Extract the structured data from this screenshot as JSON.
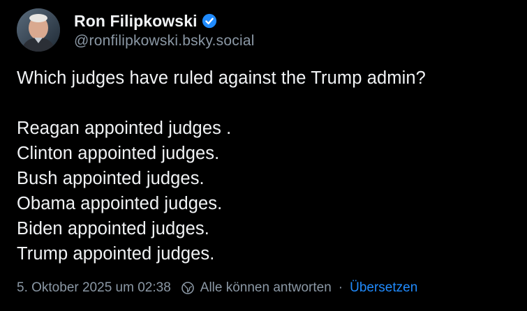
{
  "author": {
    "display_name": "Ron Filipkowski",
    "handle": "@ronfilipkowski.bsky.social",
    "verified_icon": "verified-checkmark-icon",
    "accent_color": "#208bfe"
  },
  "post": {
    "lines": [
      "Which judges have ruled against the Trump admin?",
      "",
      "Reagan appointed judges .",
      "Clinton appointed judges.",
      "Bush appointed judges.",
      "Obama appointed judges.",
      "Biden appointed judges.",
      "Trump appointed judges."
    ]
  },
  "meta": {
    "timestamp": "5. Oktober 2025 um 02:38",
    "reply_setting_icon": "globe-icon",
    "reply_setting": "Alle können antworten",
    "separator": "·",
    "translate_label": "Übersetzen"
  }
}
